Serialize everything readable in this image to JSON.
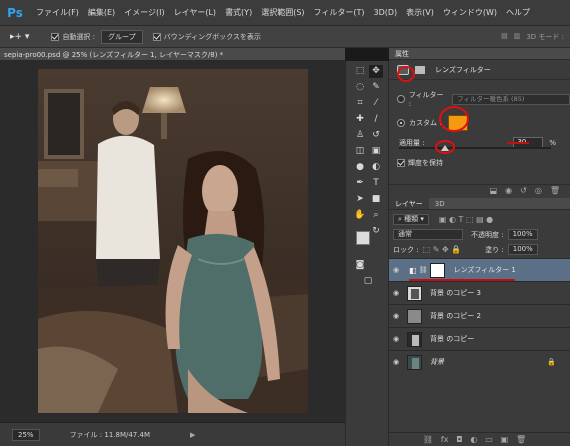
{
  "app": {
    "logo": "Ps"
  },
  "menu": [
    "ファイル(F)",
    "編集(E)",
    "イメージ(I)",
    "レイヤー(L)",
    "書式(Y)",
    "選択範囲(S)",
    "フィルター(T)",
    "3D(D)",
    "表示(V)",
    "ウィンドウ(W)",
    "ヘルプ"
  ],
  "options": {
    "move_tool": "▸+ ▾",
    "auto_select_label": "自動選択 :",
    "auto_select_checked": true,
    "auto_select_value": "グループ",
    "bounding_label": "バウンディングボックスを表示",
    "bounding_checked": true,
    "mode_label": "3D モード :"
  },
  "document": {
    "tab_title": "sepia-pro00.psd @ 25% (レンズフィルター 1, レイヤーマスク/8) *",
    "close": "×"
  },
  "status": {
    "zoom": "25%",
    "file_info": "ファイル : 11.8M/47.4M",
    "arrow": "▶"
  },
  "properties": {
    "header": "属性",
    "title": "レンズフィルター",
    "filter_label": "フィルター :",
    "filter_value": "フィルター暖色系 (85)",
    "custom_label": "カスタム :",
    "custom_color": "#f39a0e",
    "opacity_label": "適用量 :",
    "opacity_value": "30",
    "opacity_unit": "%",
    "opacity_fraction": 0.3,
    "preserve_label": "輝度を保持",
    "preserve_checked": true
  },
  "layers": {
    "tab_layers": "レイヤー",
    "tab_3d": "3D",
    "kind_label": "種類",
    "blend_mode": "通常",
    "opacity_label": "不透明度 :",
    "opacity_value": "100%",
    "lock_label": "ロック :",
    "fill_label": "塗り :",
    "fill_value": "100%",
    "items": [
      {
        "name": "レンズフィルター 1",
        "selected": true,
        "locked": false
      },
      {
        "name": "背景 のコピー 3",
        "selected": false,
        "locked": false
      },
      {
        "name": "背景 のコピー 2",
        "selected": false,
        "locked": false
      },
      {
        "name": "背景 のコピー",
        "selected": false,
        "locked": false
      },
      {
        "name": "背景",
        "selected": false,
        "locked": true
      }
    ]
  },
  "colors": {
    "accent_annotation": "#e01010",
    "selected_layer": "#5b6f87"
  }
}
